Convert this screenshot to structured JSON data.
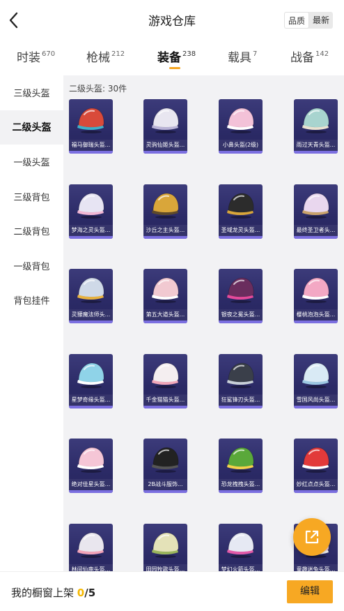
{
  "header": {
    "title": "游戏仓库",
    "sort_options": [
      "品质",
      "最新"
    ],
    "active_sort": "品质"
  },
  "tabs": [
    {
      "label": "时装",
      "count": "670"
    },
    {
      "label": "枪械",
      "count": "212"
    },
    {
      "label": "装备",
      "count": "238"
    },
    {
      "label": "载具",
      "count": "7"
    },
    {
      "label": "战备",
      "count": "142"
    }
  ],
  "active_tab": "装备",
  "sidebar": {
    "items": [
      {
        "label": "三级头盔"
      },
      {
        "label": "二级头盔"
      },
      {
        "label": "一级头盔"
      },
      {
        "label": "三级背包"
      },
      {
        "label": "二级背包"
      },
      {
        "label": "一级背包"
      },
      {
        "label": "背包挂件"
      }
    ],
    "active": "二级头盔"
  },
  "content": {
    "count_label": "二级头盔: 30件",
    "items": [
      {
        "label": "福马御瑞头盔...",
        "color": "#d94a3a",
        "accent": "#3fb0c9"
      },
      {
        "label": "灵驹仙姬头盔...",
        "color": "#e8e6f0",
        "accent": "#b9b3d6"
      },
      {
        "label": "小鼻头盔(2级)",
        "color": "#f3c2d8",
        "accent": "#ffffff"
      },
      {
        "label": "雨过天青头盔...",
        "color": "#a8d4cf",
        "accent": "#e9e1d0"
      },
      {
        "label": "梦海之灵头盔...",
        "color": "#e7e4f3",
        "accent": "#f2b7d4"
      },
      {
        "label": "沙丘之主头盔...",
        "color": "#d9a63a",
        "accent": "#5e4a2a"
      },
      {
        "label": "圣域龙灵头盔...",
        "color": "#2c2c2c",
        "accent": "#d8a63a"
      },
      {
        "label": "最终圣卫者头...",
        "color": "#e9d7ee",
        "accent": "#c9a26b"
      },
      {
        "label": "灵獴魔法师头...",
        "color": "#cfd9e8",
        "accent": "#e8b23f"
      },
      {
        "label": "第五大道头盔...",
        "color": "#f1c9d1",
        "accent": "#ffffff"
      },
      {
        "label": "银夜之冕头盔...",
        "color": "#6a2d5e",
        "accent": "#e54a9a"
      },
      {
        "label": "樱桃泡泡头盔...",
        "color": "#f3a8c4",
        "accent": "#ffffff"
      },
      {
        "label": "星梦奇缘头盔...",
        "color": "#8fd3e8",
        "accent": "#ffffff"
      },
      {
        "label": "千金猫猫头盔...",
        "color": "#f4eef0",
        "accent": "#f1a7b9"
      },
      {
        "label": "狂鲨锋刃头盔...",
        "color": "#3a3f4a",
        "accent": "#c8d0d8"
      },
      {
        "label": "雪国风尚头盔...",
        "color": "#d9eaf5",
        "accent": "#9cc7e2"
      },
      {
        "label": "绝对佳星头盔...",
        "color": "#f5c6d6",
        "accent": "#ffffff"
      },
      {
        "label": "2B战斗服饰...",
        "color": "#222222",
        "accent": "#555555"
      },
      {
        "label": "恐龙拽拽头盔...",
        "color": "#5aa83a",
        "accent": "#f3d14b"
      },
      {
        "label": "妙红点点头盔...",
        "color": "#e23a3a",
        "accent": "#ffffff"
      },
      {
        "label": "林间仙鹿头盔...",
        "color": "#e9e6ee",
        "accent": "#f2a3b8"
      },
      {
        "label": "田园牧歌头盔...",
        "color": "#e4e2b8",
        "accent": "#9ab55c"
      },
      {
        "label": "梦幻火箭头盔...",
        "color": "#e6e9f3",
        "accent": "#e25aa8"
      },
      {
        "label": "童趣迷兔头盔...",
        "color": "#f6d0da",
        "accent": "#ffffff"
      }
    ]
  },
  "bottom_bar": {
    "shelf_label": "我的橱窗上架",
    "shelf_count": "0",
    "shelf_max": "/5",
    "edit_label": "编辑"
  },
  "colors": {
    "accent": "#f7a823",
    "card_bg": "#2f2e6c",
    "content_bg": "#f2f2f4"
  }
}
